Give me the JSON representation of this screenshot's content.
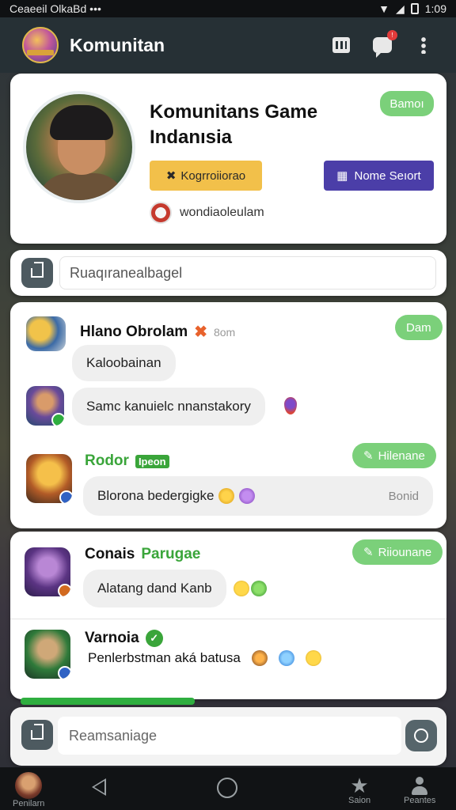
{
  "status_bar": {
    "carrier": "Ceaeeil OlkaBd",
    "dots": "•••",
    "time": "1:09"
  },
  "app_bar": {
    "title": "Komunitan"
  },
  "profile": {
    "group_name": "Komunitans Game Indanısia",
    "badge": "Bamoı",
    "yellow_button": "Kogrroiiorao",
    "purple_button": "Nome Seıort",
    "handle": "wondiaoleulam"
  },
  "search": {
    "placeholder": "Ruaqıranealbagel"
  },
  "chat": {
    "message1": {
      "sender": "Hlano Obrolam",
      "time": "8om",
      "badge": "Dam",
      "bubble1": "Kaloobainan",
      "bubble2": "Samc kanuielc nnanstakory"
    },
    "message2": {
      "sender": "Rodor",
      "tag": "Ipeon",
      "action": "Hilenane",
      "bubble": "Blorona bedergigke",
      "note": "Bonid"
    }
  },
  "thread": {
    "message1": {
      "sender": "Conais",
      "tag": "Parugae",
      "action": "Riiounane",
      "bubble": "Alatang dand Kanb"
    },
    "message2": {
      "sender": "Varnoia",
      "bubble": "Penlerbstman aká batusa"
    }
  },
  "compose": {
    "placeholder": "Reamsaniage"
  },
  "bottom_nav": {
    "profile_label": "Penilarn",
    "star_label": "Saion",
    "people_label": "Peantes"
  },
  "colors": {
    "accent_green": "#7bd07a",
    "yellow": "#f2c04a",
    "purple": "#4b3ea8",
    "appbar": "#263035"
  }
}
